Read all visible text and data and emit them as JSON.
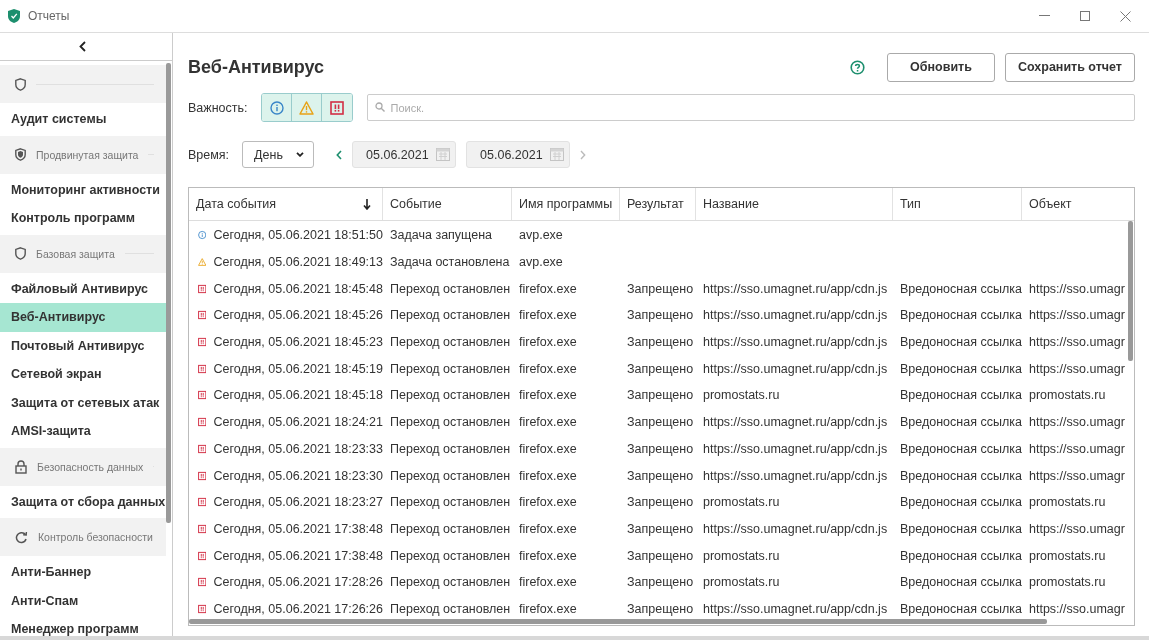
{
  "window": {
    "title": "Отчеты"
  },
  "sidebar": {
    "items": [
      {
        "kind": "group"
      },
      {
        "kind": "item",
        "label": "Аудит системы",
        "selected": false
      },
      {
        "kind": "group",
        "label": "Продвинутая защита"
      },
      {
        "kind": "item",
        "label": "Мониторинг активности",
        "selected": false
      },
      {
        "kind": "item",
        "label": "Контроль программ",
        "selected": false
      },
      {
        "kind": "group",
        "label": "Базовая защита"
      },
      {
        "kind": "item",
        "label": "Файловый Антивирус",
        "selected": false
      },
      {
        "kind": "item",
        "label": "Веб-Антивирус",
        "selected": true
      },
      {
        "kind": "item",
        "label": "Почтовый Антивирус",
        "selected": false
      },
      {
        "kind": "item",
        "label": "Сетевой экран",
        "selected": false
      },
      {
        "kind": "item",
        "label": "Защита от сетевых атак",
        "selected": false
      },
      {
        "kind": "item",
        "label": "AMSI-защита",
        "selected": false
      },
      {
        "kind": "group",
        "label": "Безопасность данных"
      },
      {
        "kind": "item",
        "label": "Защита от сбора данных",
        "selected": false
      },
      {
        "kind": "group",
        "label": "Контроль безопасности"
      },
      {
        "kind": "item",
        "label": "Анти-Баннер",
        "selected": false
      },
      {
        "kind": "item",
        "label": "Анти-Спам",
        "selected": false
      },
      {
        "kind": "item",
        "label": "Менеджер программ",
        "selected": false
      }
    ]
  },
  "header": {
    "title": "Веб-Антивирус",
    "buttons": [
      "Обновить",
      "Сохранить отчет"
    ]
  },
  "filters": {
    "severity_label": "Важность:",
    "severity": [
      {
        "kind": "info",
        "selected": true
      },
      {
        "kind": "warning",
        "selected": true
      },
      {
        "kind": "error",
        "selected": true
      }
    ],
    "search": {
      "placeholder": "Поиск."
    },
    "time_label": "Время:",
    "period": "День",
    "date_from": "05.06.2021",
    "date_to": "05.06.2021"
  },
  "table": {
    "columns": [
      "Дата события",
      "Событие",
      "Имя программы",
      "Результат",
      "Название",
      "Тип",
      "Объект"
    ],
    "rows": [
      {
        "kind": "info",
        "cells": [
          "Сегодня, 05.06.2021 18:51:50",
          "Задача запущена",
          "avp.exe",
          "",
          "",
          "",
          ""
        ]
      },
      {
        "kind": "warning",
        "cells": [
          "Сегодня, 05.06.2021 18:49:13",
          "Задача остановлена",
          "avp.exe",
          "",
          "",
          "",
          ""
        ]
      },
      {
        "kind": "error",
        "cells": [
          "Сегодня, 05.06.2021 18:45:48",
          "Переход остановлен",
          "firefox.exe",
          "Запрещено",
          "https://sso.umagnet.ru/app/cdn.js",
          "Вредоносная ссылка",
          "https://sso.umagr"
        ]
      },
      {
        "kind": "error",
        "cells": [
          "Сегодня, 05.06.2021 18:45:26",
          "Переход остановлен",
          "firefox.exe",
          "Запрещено",
          "https://sso.umagnet.ru/app/cdn.js",
          "Вредоносная ссылка",
          "https://sso.umagr"
        ]
      },
      {
        "kind": "error",
        "cells": [
          "Сегодня, 05.06.2021 18:45:23",
          "Переход остановлен",
          "firefox.exe",
          "Запрещено",
          "https://sso.umagnet.ru/app/cdn.js",
          "Вредоносная ссылка",
          "https://sso.umagr"
        ]
      },
      {
        "kind": "error",
        "cells": [
          "Сегодня, 05.06.2021 18:45:19",
          "Переход остановлен",
          "firefox.exe",
          "Запрещено",
          "https://sso.umagnet.ru/app/cdn.js",
          "Вредоносная ссылка",
          "https://sso.umagr"
        ]
      },
      {
        "kind": "error",
        "cells": [
          "Сегодня, 05.06.2021 18:45:18",
          "Переход остановлен",
          "firefox.exe",
          "Запрещено",
          "promostats.ru",
          "Вредоносная ссылка",
          "promostats.ru"
        ]
      },
      {
        "kind": "error",
        "cells": [
          "Сегодня, 05.06.2021 18:24:21",
          "Переход остановлен",
          "firefox.exe",
          "Запрещено",
          "https://sso.umagnet.ru/app/cdn.js",
          "Вредоносная ссылка",
          "https://sso.umagr"
        ]
      },
      {
        "kind": "error",
        "cells": [
          "Сегодня, 05.06.2021 18:23:33",
          "Переход остановлен",
          "firefox.exe",
          "Запрещено",
          "https://sso.umagnet.ru/app/cdn.js",
          "Вредоносная ссылка",
          "https://sso.umagr"
        ]
      },
      {
        "kind": "error",
        "cells": [
          "Сегодня, 05.06.2021 18:23:30",
          "Переход остановлен",
          "firefox.exe",
          "Запрещено",
          "https://sso.umagnet.ru/app/cdn.js",
          "Вредоносная ссылка",
          "https://sso.umagr"
        ]
      },
      {
        "kind": "error",
        "cells": [
          "Сегодня, 05.06.2021 18:23:27",
          "Переход остановлен",
          "firefox.exe",
          "Запрещено",
          "promostats.ru",
          "Вредоносная ссылка",
          "promostats.ru"
        ]
      },
      {
        "kind": "error",
        "cells": [
          "Сегодня, 05.06.2021 17:38:48",
          "Переход остановлен",
          "firefox.exe",
          "Запрещено",
          "https://sso.umagnet.ru/app/cdn.js",
          "Вредоносная ссылка",
          "https://sso.umagr"
        ]
      },
      {
        "kind": "error",
        "cells": [
          "Сегодня, 05.06.2021 17:38:48",
          "Переход остановлен",
          "firefox.exe",
          "Запрещено",
          "promostats.ru",
          "Вредоносная ссылка",
          "promostats.ru"
        ]
      },
      {
        "kind": "error",
        "cells": [
          "Сегодня, 05.06.2021 17:28:26",
          "Переход остановлен",
          "firefox.exe",
          "Запрещено",
          "promostats.ru",
          "Вредоносная ссылка",
          "promostats.ru"
        ]
      },
      {
        "kind": "error",
        "cells": [
          "Сегодня, 05.06.2021 17:26:26",
          "Переход остановлен",
          "firefox.exe",
          "Запрещено",
          "https://sso.umagnet.ru/app/cdn.js",
          "Вредоносная ссылка",
          "https://sso.umagr"
        ]
      }
    ]
  }
}
